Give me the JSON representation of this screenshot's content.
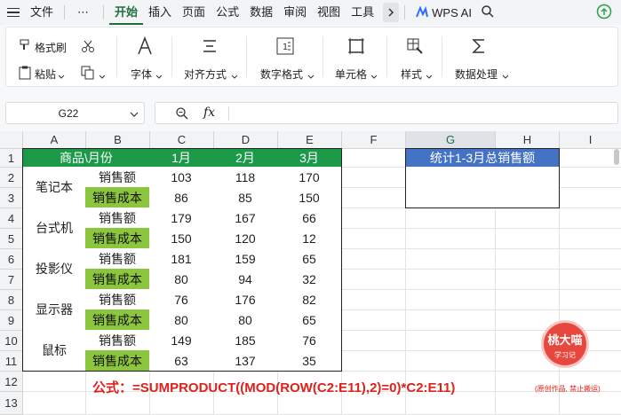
{
  "menu": {
    "file": "文件",
    "more": "⋯",
    "items": [
      "开始",
      "插入",
      "页面",
      "公式",
      "数据",
      "审阅",
      "视图",
      "工具"
    ],
    "wps_ai": "WPS AI"
  },
  "ribbon": {
    "format_painter": "格式刷",
    "paste": "粘贴",
    "font": "字体",
    "align": "对齐方式",
    "number_format": "数字格式",
    "cell": "单元格",
    "style": "样式",
    "data_process": "数据处理"
  },
  "formula_bar": {
    "name_box": "G22",
    "fx": "fx",
    "content": ""
  },
  "grid": {
    "columns": [
      "A",
      "B",
      "C",
      "D",
      "E",
      "F",
      "G",
      "H",
      "I"
    ],
    "rows": [
      "1",
      "2",
      "3",
      "4",
      "5",
      "6",
      "7",
      "8",
      "9",
      "10",
      "11",
      "12",
      "13"
    ],
    "header": {
      "product_month": "商品\\月份",
      "months": [
        "1月",
        "2月",
        "3月"
      ]
    },
    "products": [
      {
        "name": "笔记本",
        "sales_label": "销售额",
        "cost_label": "销售成本",
        "sales": [
          "103",
          "118",
          "170"
        ],
        "cost": [
          "86",
          "85",
          "150"
        ]
      },
      {
        "name": "台式机",
        "sales_label": "销售额",
        "cost_label": "销售成本",
        "sales": [
          "179",
          "167",
          "66"
        ],
        "cost": [
          "150",
          "120",
          "12"
        ]
      },
      {
        "name": "投影仪",
        "sales_label": "销售额",
        "cost_label": "销售成本",
        "sales": [
          "181",
          "159",
          "65"
        ],
        "cost": [
          "80",
          "94",
          "32"
        ]
      },
      {
        "name": "显示器",
        "sales_label": "销售额",
        "cost_label": "销售成本",
        "sales": [
          "76",
          "176",
          "82"
        ],
        "cost": [
          "80",
          "80",
          "65"
        ]
      },
      {
        "name": "鼠标",
        "sales_label": "销售额",
        "cost_label": "销售成本",
        "sales": [
          "149",
          "185",
          "76"
        ],
        "cost": [
          "63",
          "137",
          "35"
        ]
      }
    ],
    "stat_header": "统计1-3月总销售额",
    "stat_value": "",
    "formula": "公式：=SUMPRODUCT((MOD(ROW(C2:E11),2)=0)*C2:E11)",
    "formula_note": "(原创作品, 禁止搬运)"
  },
  "badge": {
    "line1": "桃大喵",
    "line2": "学习记"
  },
  "colors": {
    "header_green": "#1c9a49",
    "label_green": "#8cc63f",
    "stat_blue": "#4472c4",
    "formula_red": "#e0201b",
    "active_tab": "#1e6f3e"
  }
}
